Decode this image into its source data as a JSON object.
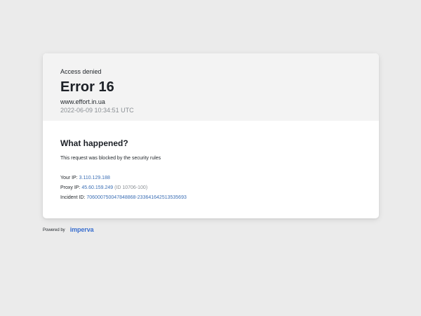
{
  "header": {
    "status": "Access denied",
    "title": "Error 16",
    "domain": "www.effort.in.ua",
    "timestamp": "2022-06-09 10:34:51 UTC"
  },
  "body": {
    "heading": "What happened?",
    "message": "This request was blocked by the security rules",
    "your_ip_label": "Your IP:",
    "your_ip": "3.110.129.188",
    "proxy_ip_label": "Proxy IP:",
    "proxy_ip": "45.60.159.249",
    "proxy_id": "(ID 10706-100)",
    "incident_label": "Incident ID:",
    "incident_id": "706000750047848868-233641642513535693"
  },
  "footer": {
    "powered_by": "Powered by",
    "logo_text": "imperva"
  },
  "colors": {
    "background": "#ebebeb",
    "header_bg": "#f3f3f3",
    "link": "#3c6fb5",
    "logo": "#3a6fcf"
  }
}
